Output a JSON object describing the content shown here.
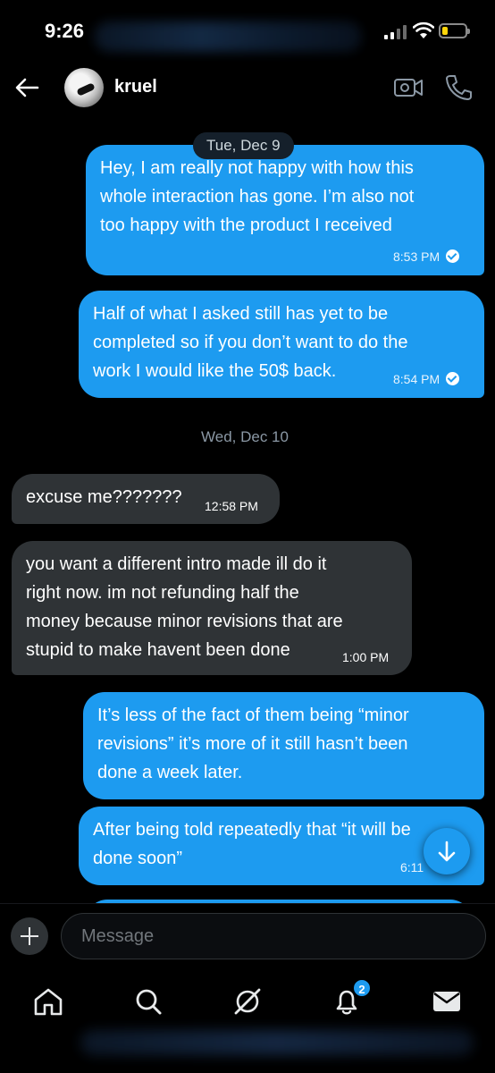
{
  "status_bar": {
    "time": "9:26"
  },
  "header": {
    "contact_name": "kruel",
    "icons": [
      "back-arrow-icon",
      "video-camera-icon",
      "phone-icon"
    ]
  },
  "conversation": {
    "date_1": "Tue, Dec 9",
    "date_2": "Wed, Dec 10",
    "messages": [
      {
        "direction": "outgoing",
        "lines": [
          "Hey, I am really not happy with how this",
          "whole interaction has gone. I’m also not",
          "too happy with the product I received"
        ],
        "time": "8:53 PM",
        "read": true
      },
      {
        "direction": "outgoing",
        "lines": [
          "Half of what I asked still has yet to be",
          "completed so if you don’t want to do the",
          "work I would like the 50$ back."
        ],
        "time": "8:54 PM",
        "read": true
      },
      {
        "direction": "incoming",
        "lines": [
          "excuse me???????"
        ],
        "time": "12:58 PM"
      },
      {
        "direction": "incoming",
        "lines": [
          "you want a different intro made ill do it",
          "right now. im not refunding half the",
          "money because minor revisions that are",
          "stupid to make havent been done"
        ],
        "time": "1:00 PM"
      },
      {
        "direction": "outgoing",
        "lines": [
          "It’s less of the fact of them being “minor",
          "revisions” it’s more of it still hasn’t been",
          "done a week later."
        ]
      },
      {
        "direction": "outgoing",
        "lines": [
          "After being told repeatedly that “it will be",
          "done soon”"
        ],
        "time": "6:11"
      }
    ]
  },
  "composer": {
    "placeholder": "Message"
  },
  "bottom_nav": {
    "items": [
      "home-icon",
      "search-icon",
      "grok-icon",
      "notifications-icon",
      "messages-icon"
    ],
    "notifications_badge": "2"
  },
  "colors": {
    "accent": "#1d9bf0",
    "incoming_bubble": "#2f3336",
    "background": "#000000"
  }
}
